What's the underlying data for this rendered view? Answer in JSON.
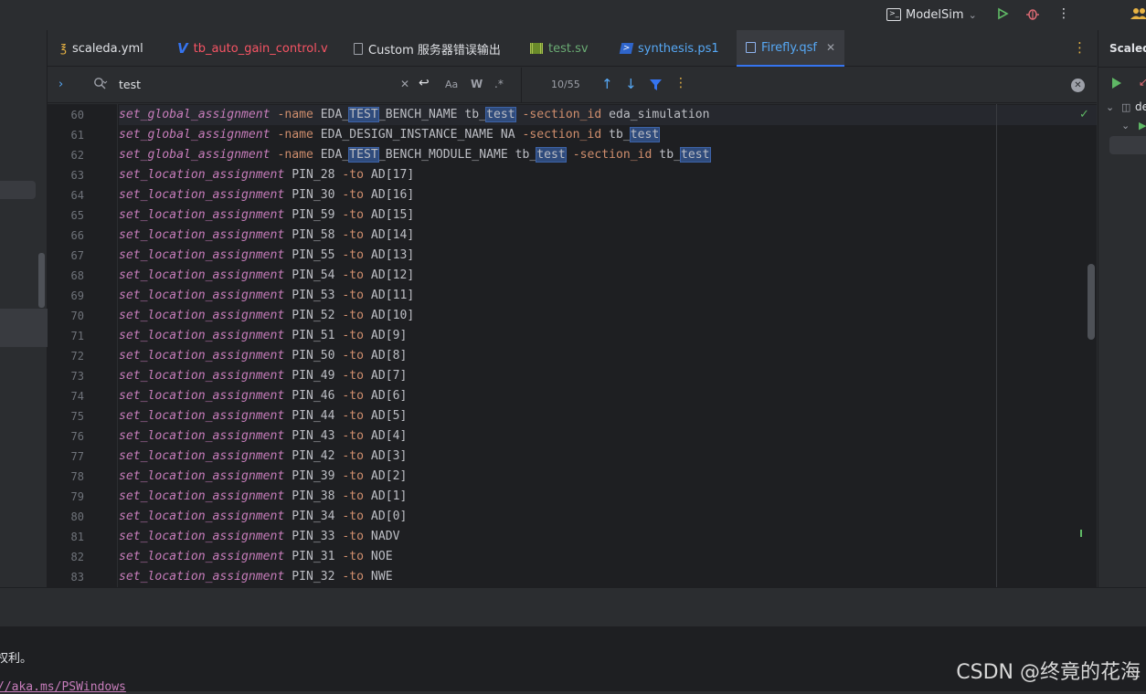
{
  "toolbar": {
    "run_config_label": "ModelSim"
  },
  "tabs": [
    {
      "label": "scaleda.yml",
      "icon": "yaml-file-icon",
      "color": "#dfe1e5"
    },
    {
      "label": "tb_auto_gain_control.v",
      "icon": "verilog-file-icon",
      "color": "#f75464"
    },
    {
      "label": "Custom 服务器错误输出",
      "icon": "document-icon",
      "color": "#dfe1e5"
    },
    {
      "label": "test.sv",
      "icon": "systemverilog-file-icon",
      "color": "#6aab73"
    },
    {
      "label": "synthesis.ps1",
      "icon": "powershell-file-icon",
      "color": "#56a8f5"
    },
    {
      "label": "Firefly.qsf",
      "icon": "qsf-file-icon",
      "color": "#56a8f5",
      "active": true
    }
  ],
  "right_panel": {
    "title": "Scaleda",
    "tree_item": "de"
  },
  "search": {
    "query": "test",
    "match_case_label": "Aa",
    "words_label": "W",
    "regex_label": ".*",
    "result_count": "10/55"
  },
  "code_lines": [
    {
      "n": "60",
      "parts": [
        [
          "kw",
          "set_global_assignment"
        ],
        [
          "t",
          " "
        ],
        [
          "fl",
          "-name"
        ],
        [
          "t",
          " EDA_"
        ],
        [
          "hl",
          "TEST"
        ],
        [
          "t",
          "_BENCH_NAME tb_"
        ],
        [
          "hl",
          "test"
        ],
        [
          "t",
          " "
        ],
        [
          "fl",
          "-section_id"
        ],
        [
          "t",
          " eda_simulation"
        ]
      ]
    },
    {
      "n": "61",
      "parts": [
        [
          "kw",
          "set_global_assignment"
        ],
        [
          "t",
          " "
        ],
        [
          "fl",
          "-name"
        ],
        [
          "t",
          " EDA_DESIGN_INSTANCE_NAME NA "
        ],
        [
          "fl",
          "-section_id"
        ],
        [
          "t",
          " tb_"
        ],
        [
          "hl",
          "test"
        ]
      ]
    },
    {
      "n": "62",
      "parts": [
        [
          "kw",
          "set_global_assignment"
        ],
        [
          "t",
          " "
        ],
        [
          "fl",
          "-name"
        ],
        [
          "t",
          " EDA_"
        ],
        [
          "hl",
          "TEST"
        ],
        [
          "t",
          "_BENCH_MODULE_NAME tb_"
        ],
        [
          "hl",
          "test"
        ],
        [
          "t",
          " "
        ],
        [
          "fl",
          "-section_id"
        ],
        [
          "t",
          " tb_"
        ],
        [
          "hl",
          "test"
        ]
      ]
    },
    {
      "n": "63",
      "parts": [
        [
          "kw",
          "set_location_assignment"
        ],
        [
          "t",
          " PIN_28 "
        ],
        [
          "fl",
          "-to"
        ],
        [
          "t",
          " AD[17]"
        ]
      ]
    },
    {
      "n": "64",
      "parts": [
        [
          "kw",
          "set_location_assignment"
        ],
        [
          "t",
          " PIN_30 "
        ],
        [
          "fl",
          "-to"
        ],
        [
          "t",
          " AD[16]"
        ]
      ]
    },
    {
      "n": "65",
      "parts": [
        [
          "kw",
          "set_location_assignment"
        ],
        [
          "t",
          " PIN_59 "
        ],
        [
          "fl",
          "-to"
        ],
        [
          "t",
          " AD[15]"
        ]
      ]
    },
    {
      "n": "66",
      "parts": [
        [
          "kw",
          "set_location_assignment"
        ],
        [
          "t",
          " PIN_58 "
        ],
        [
          "fl",
          "-to"
        ],
        [
          "t",
          " AD[14]"
        ]
      ]
    },
    {
      "n": "67",
      "parts": [
        [
          "kw",
          "set_location_assignment"
        ],
        [
          "t",
          " PIN_55 "
        ],
        [
          "fl",
          "-to"
        ],
        [
          "t",
          " AD[13]"
        ]
      ]
    },
    {
      "n": "68",
      "parts": [
        [
          "kw",
          "set_location_assignment"
        ],
        [
          "t",
          " PIN_54 "
        ],
        [
          "fl",
          "-to"
        ],
        [
          "t",
          " AD[12]"
        ]
      ]
    },
    {
      "n": "69",
      "parts": [
        [
          "kw",
          "set_location_assignment"
        ],
        [
          "t",
          " PIN_53 "
        ],
        [
          "fl",
          "-to"
        ],
        [
          "t",
          " AD[11]"
        ]
      ]
    },
    {
      "n": "70",
      "parts": [
        [
          "kw",
          "set_location_assignment"
        ],
        [
          "t",
          " PIN_52 "
        ],
        [
          "fl",
          "-to"
        ],
        [
          "t",
          " AD[10]"
        ]
      ]
    },
    {
      "n": "71",
      "parts": [
        [
          "kw",
          "set_location_assignment"
        ],
        [
          "t",
          " PIN_51 "
        ],
        [
          "fl",
          "-to"
        ],
        [
          "t",
          " AD[9]"
        ]
      ]
    },
    {
      "n": "72",
      "parts": [
        [
          "kw",
          "set_location_assignment"
        ],
        [
          "t",
          " PIN_50 "
        ],
        [
          "fl",
          "-to"
        ],
        [
          "t",
          " AD[8]"
        ]
      ]
    },
    {
      "n": "73",
      "parts": [
        [
          "kw",
          "set_location_assignment"
        ],
        [
          "t",
          " PIN_49 "
        ],
        [
          "fl",
          "-to"
        ],
        [
          "t",
          " AD[7]"
        ]
      ]
    },
    {
      "n": "74",
      "parts": [
        [
          "kw",
          "set_location_assignment"
        ],
        [
          "t",
          " PIN_46 "
        ],
        [
          "fl",
          "-to"
        ],
        [
          "t",
          " AD[6]"
        ]
      ]
    },
    {
      "n": "75",
      "parts": [
        [
          "kw",
          "set_location_assignment"
        ],
        [
          "t",
          " PIN_44 "
        ],
        [
          "fl",
          "-to"
        ],
        [
          "t",
          " AD[5]"
        ]
      ]
    },
    {
      "n": "76",
      "parts": [
        [
          "kw",
          "set_location_assignment"
        ],
        [
          "t",
          " PIN_43 "
        ],
        [
          "fl",
          "-to"
        ],
        [
          "t",
          " AD[4]"
        ]
      ]
    },
    {
      "n": "77",
      "parts": [
        [
          "kw",
          "set_location_assignment"
        ],
        [
          "t",
          " PIN_42 "
        ],
        [
          "fl",
          "-to"
        ],
        [
          "t",
          " AD[3]"
        ]
      ]
    },
    {
      "n": "78",
      "parts": [
        [
          "kw",
          "set_location_assignment"
        ],
        [
          "t",
          " PIN_39 "
        ],
        [
          "fl",
          "-to"
        ],
        [
          "t",
          " AD[2]"
        ]
      ]
    },
    {
      "n": "79",
      "parts": [
        [
          "kw",
          "set_location_assignment"
        ],
        [
          "t",
          " PIN_38 "
        ],
        [
          "fl",
          "-to"
        ],
        [
          "t",
          " AD[1]"
        ]
      ]
    },
    {
      "n": "80",
      "parts": [
        [
          "kw",
          "set_location_assignment"
        ],
        [
          "t",
          " PIN_34 "
        ],
        [
          "fl",
          "-to"
        ],
        [
          "t",
          " AD[0]"
        ]
      ]
    },
    {
      "n": "81",
      "parts": [
        [
          "kw",
          "set_location_assignment"
        ],
        [
          "t",
          " PIN_33 "
        ],
        [
          "fl",
          "-to"
        ],
        [
          "t",
          " NADV"
        ]
      ]
    },
    {
      "n": "82",
      "parts": [
        [
          "kw",
          "set_location_assignment"
        ],
        [
          "t",
          " PIN_31 "
        ],
        [
          "fl",
          "-to"
        ],
        [
          "t",
          " NOE"
        ]
      ]
    },
    {
      "n": "83",
      "parts": [
        [
          "kw",
          "set_location_assignment"
        ],
        [
          "t",
          " PIN_32 "
        ],
        [
          "fl",
          "-to"
        ],
        [
          "t",
          " NWE"
        ]
      ]
    }
  ],
  "terminal": {
    "line1": "权利。",
    "line2": "//aka.ms/PSWindows"
  },
  "watermark": "CSDN @终竟的花海",
  "colors": {
    "accent": "#3574f0",
    "keyword": "#c77dbb",
    "flag": "#cf8e6d",
    "run_green": "#5fb865",
    "debug_red": "#e06c75"
  }
}
